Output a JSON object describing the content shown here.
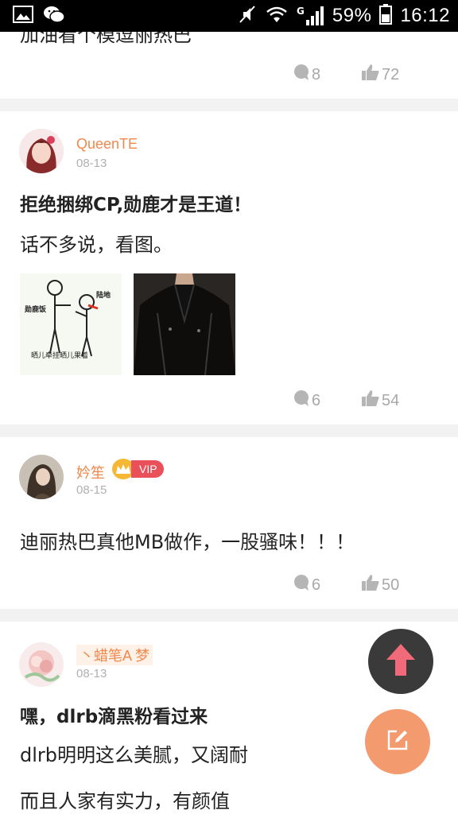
{
  "status_bar": {
    "network_type": "G",
    "battery": "59%",
    "time": "16:12"
  },
  "posts": [
    {
      "body": "加油看个模逗丽热巴",
      "comments": "8",
      "likes": "72"
    },
    {
      "username": "QueenTE",
      "date": "08-13",
      "title": "拒绝捆绑CP,勋鹿才是王道！",
      "body": "话不多说，看图。",
      "image_texts": [
        "勋鹿饭",
        "陆地",
        "晒儿牵挂晒儿果着"
      ],
      "comments": "6",
      "likes": "54"
    },
    {
      "username": "妗笙",
      "badge": "VIP",
      "date": "08-15",
      "body": "迪丽热巴真他MB做作，一股骚味！！！",
      "comments": "6",
      "likes": "50"
    },
    {
      "username": "丶蜡笔A 梦",
      "date": "08-13",
      "title": "嘿，dlrb滴黑粉看过来",
      "body": "dlrb明明这么美腻，又阔耐",
      "body2": "而且人家有实力，有颜值"
    }
  ],
  "colors": {
    "username": "#f2884b",
    "vip_badge": "#e9505a",
    "scroll_top_fab": "#3a3a3a",
    "compose_fab": "#f49a6f",
    "arrow": "#f06a7a"
  },
  "icons": [
    "gallery-icon",
    "wechat-icon",
    "mute-icon",
    "wifi-icon",
    "signal-icon",
    "battery-icon",
    "comment-icon",
    "like-icon",
    "crown-icon",
    "arrow-up-icon",
    "edit-icon"
  ]
}
